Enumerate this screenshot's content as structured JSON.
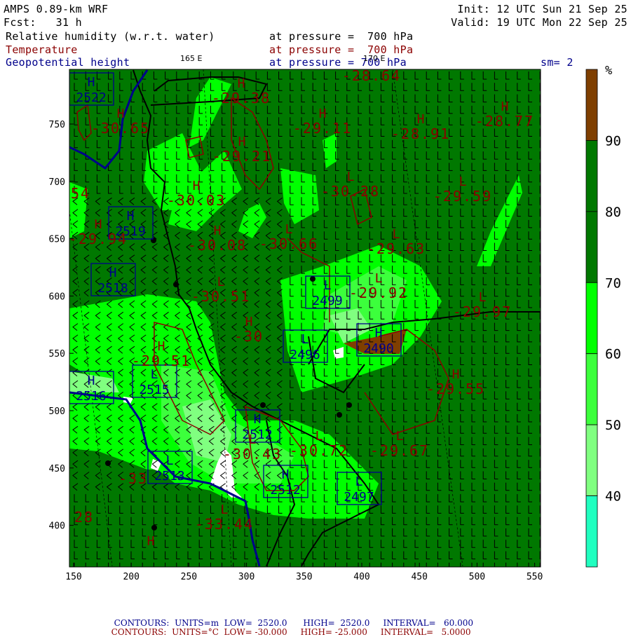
{
  "header": {
    "model": "AMPS 0.89-km WRF",
    "forecast": "Fcst:   31 h",
    "init": "Init: 12 UTC Sun 21 Sep 25",
    "valid": "Valid: 19 UTC Mon 22 Sep 25",
    "field1": "Relative humidity (w.r.t. water)",
    "field1_level": "at pressure =  700 hPa",
    "field2": "Temperature",
    "field2_level": "at pressure =  700 hPa",
    "field3": "Geopotential height",
    "field3_level": "at pressure = 700 hPa",
    "smoothing": "sm= 2",
    "lon_label_1": "165 E",
    "lon_label_2": "170 E"
  },
  "colorbar": {
    "unit": "%",
    "labels": [
      "90",
      "80",
      "70",
      "60",
      "50",
      "40"
    ],
    "colors": [
      "#7f3f00",
      "#007800",
      "#007800",
      "#00ff00",
      "#3cff3c",
      "#80ff80",
      "#20ffc0"
    ]
  },
  "axes": {
    "x_ticks": [
      "150",
      "200",
      "250",
      "300",
      "350",
      "400",
      "450",
      "500",
      "550"
    ],
    "y_ticks": [
      "750",
      "700",
      "650",
      "600",
      "550",
      "500",
      "450",
      "400"
    ]
  },
  "height_centers": [
    {
      "type": "H",
      "value": "2522"
    },
    {
      "type": "H",
      "value": "2519"
    },
    {
      "type": "H",
      "value": "2518"
    },
    {
      "type": "L",
      "value": "2499"
    },
    {
      "type": "L",
      "value": "2496"
    },
    {
      "type": "H",
      "value": "2490"
    },
    {
      "type": "H",
      "value": "2516"
    },
    {
      "type": "L",
      "value": "2515"
    },
    {
      "type": "H",
      "value": "2512"
    },
    {
      "type": "L",
      "value": "2513"
    },
    {
      "type": "H",
      "value": "2512"
    },
    {
      "type": "L",
      "value": "2497"
    }
  ],
  "temp_centers": [
    {
      "type": "H",
      "value": "-29.38"
    },
    {
      "type": "H",
      "value": "-30.65"
    },
    {
      "type": "H",
      "value": "-29.21"
    },
    {
      "type": "",
      "value": "54"
    },
    {
      "type": "H",
      "value": "-29.94"
    },
    {
      "type": "H",
      "value": "-30.03"
    },
    {
      "type": "H",
      "value": "-30.08"
    },
    {
      "type": "L",
      "value": "-30.51"
    },
    {
      "type": "",
      "value": "-28.64"
    },
    {
      "type": "H",
      "value": "-29.11"
    },
    {
      "type": "H",
      "value": "-28.91"
    },
    {
      "type": "H",
      "value": "-28.77"
    },
    {
      "type": "L",
      "value": "-30.28"
    },
    {
      "type": "L",
      "value": "-29.59"
    },
    {
      "type": "L",
      "value": "-30.66"
    },
    {
      "type": "L",
      "value": "-29.63"
    },
    {
      "type": "L",
      "value": "-29.92"
    },
    {
      "type": "L",
      "value": "-29.97"
    },
    {
      "type": "H",
      "value": "-30"
    },
    {
      "type": "H",
      "value": "-29.51"
    },
    {
      "type": "H",
      "value": "-29.55"
    },
    {
      "type": "L",
      "value": "-30.43"
    },
    {
      "type": "L",
      "value": "-30.72"
    },
    {
      "type": "L",
      "value": "-29.67"
    },
    {
      "type": "L",
      "value": "-33.44"
    },
    {
      "type": "",
      "value": "28"
    },
    {
      "type": "",
      "value": "-33"
    },
    {
      "type": "H",
      "value": ""
    }
  ],
  "footer": {
    "line1": {
      "label": "CONTOURS:",
      "units": "UNITS=m",
      "low": "LOW=  2520.0",
      "high": "HIGH=  2520.0",
      "interval": "INTERVAL=   60.000"
    },
    "line2": {
      "label": "CONTOURS:",
      "units": "UNITS=°C",
      "low": "LOW= -30.000",
      "high": "HIGH= -25.000",
      "interval": "INTERVAL=   5.0000"
    }
  }
}
